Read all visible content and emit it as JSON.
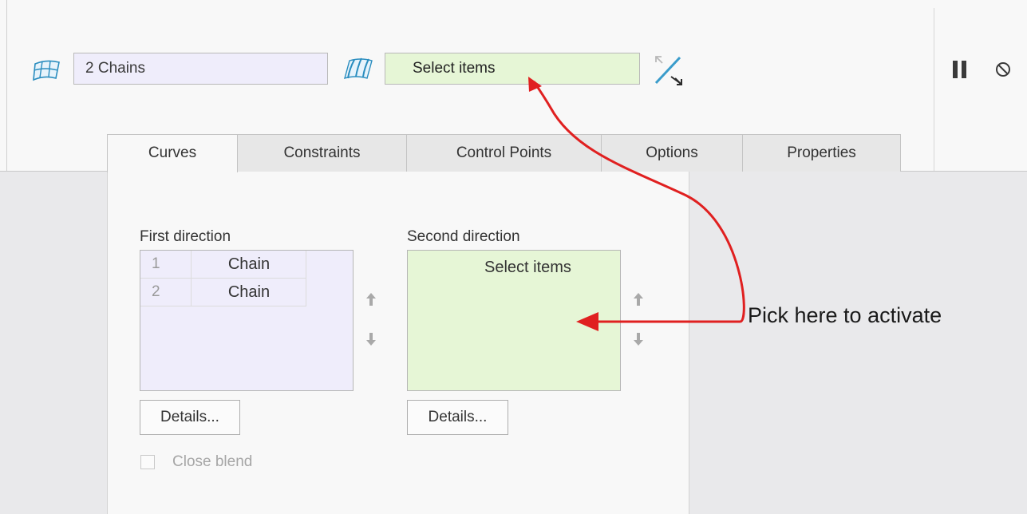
{
  "dashboard": {
    "first_icon": "surface-blend-icon",
    "first_collector_value": "2 Chains",
    "second_icon": "boundary-surface-icon",
    "second_collector_value": "Select items",
    "swap_icon": "swap-directions-icon",
    "pause_icon": "pause-icon",
    "cancel_icon": "cancel-icon"
  },
  "tabs": [
    {
      "label": "Curves",
      "active": true
    },
    {
      "label": "Constraints",
      "active": false
    },
    {
      "label": "Control Points",
      "active": false
    },
    {
      "label": "Options",
      "active": false
    },
    {
      "label": "Properties",
      "active": false
    }
  ],
  "curves_panel": {
    "first_direction": {
      "label": "First direction",
      "rows": [
        {
          "index": "1",
          "value": "Chain"
        },
        {
          "index": "2",
          "value": "Chain"
        }
      ],
      "details_label": "Details..."
    },
    "second_direction": {
      "label": "Second direction",
      "placeholder": "Select items",
      "details_label": "Details..."
    },
    "close_blend_label": "Close blend"
  },
  "annotation": {
    "callout_text": "Pick here to activate",
    "arrow_color": "#e02020"
  },
  "colors": {
    "first_collector_bg": "#efedfb",
    "second_collector_bg": "#e6f6d6"
  }
}
